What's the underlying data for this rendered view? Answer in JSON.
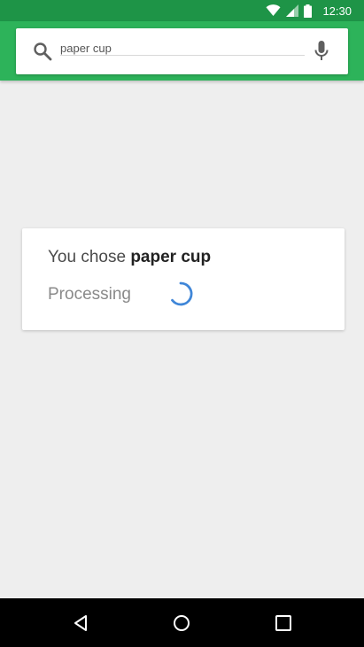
{
  "status_bar": {
    "time": "12:30",
    "icons": [
      "wifi-icon",
      "cell-signal-icon",
      "battery-icon"
    ],
    "background_color": "#1e9447"
  },
  "app_bar": {
    "color": "#2db35a"
  },
  "search": {
    "value": "paper cup",
    "icon": "search-icon",
    "voice_icon": "mic-icon"
  },
  "card": {
    "choice_prefix": "You chose",
    "choice_value": "paper cup",
    "status_text": "Processing",
    "spinner_color": "#3f86d8"
  },
  "navigation": {
    "buttons": [
      "back-icon",
      "home-icon",
      "recents-icon"
    ]
  }
}
